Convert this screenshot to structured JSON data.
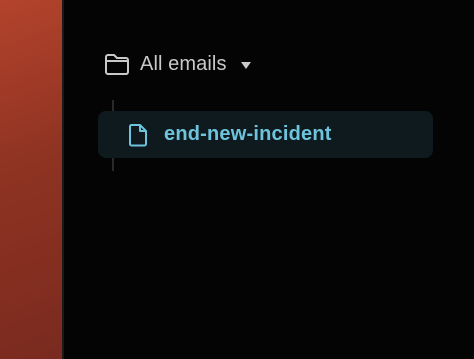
{
  "folder": {
    "label": "All emails",
    "icon": "folder-icon",
    "toggle_icon": "caret-down-icon"
  },
  "files": [
    {
      "label": "end-new-incident",
      "icon": "file-icon",
      "selected": true
    }
  ],
  "colors": {
    "accent": "#6ec4dc",
    "selected_row_bg": "#0f1a1f",
    "panel_bg": "#040404",
    "left_strip": "#9a3825",
    "folder_text": "#c9c9c9"
  }
}
